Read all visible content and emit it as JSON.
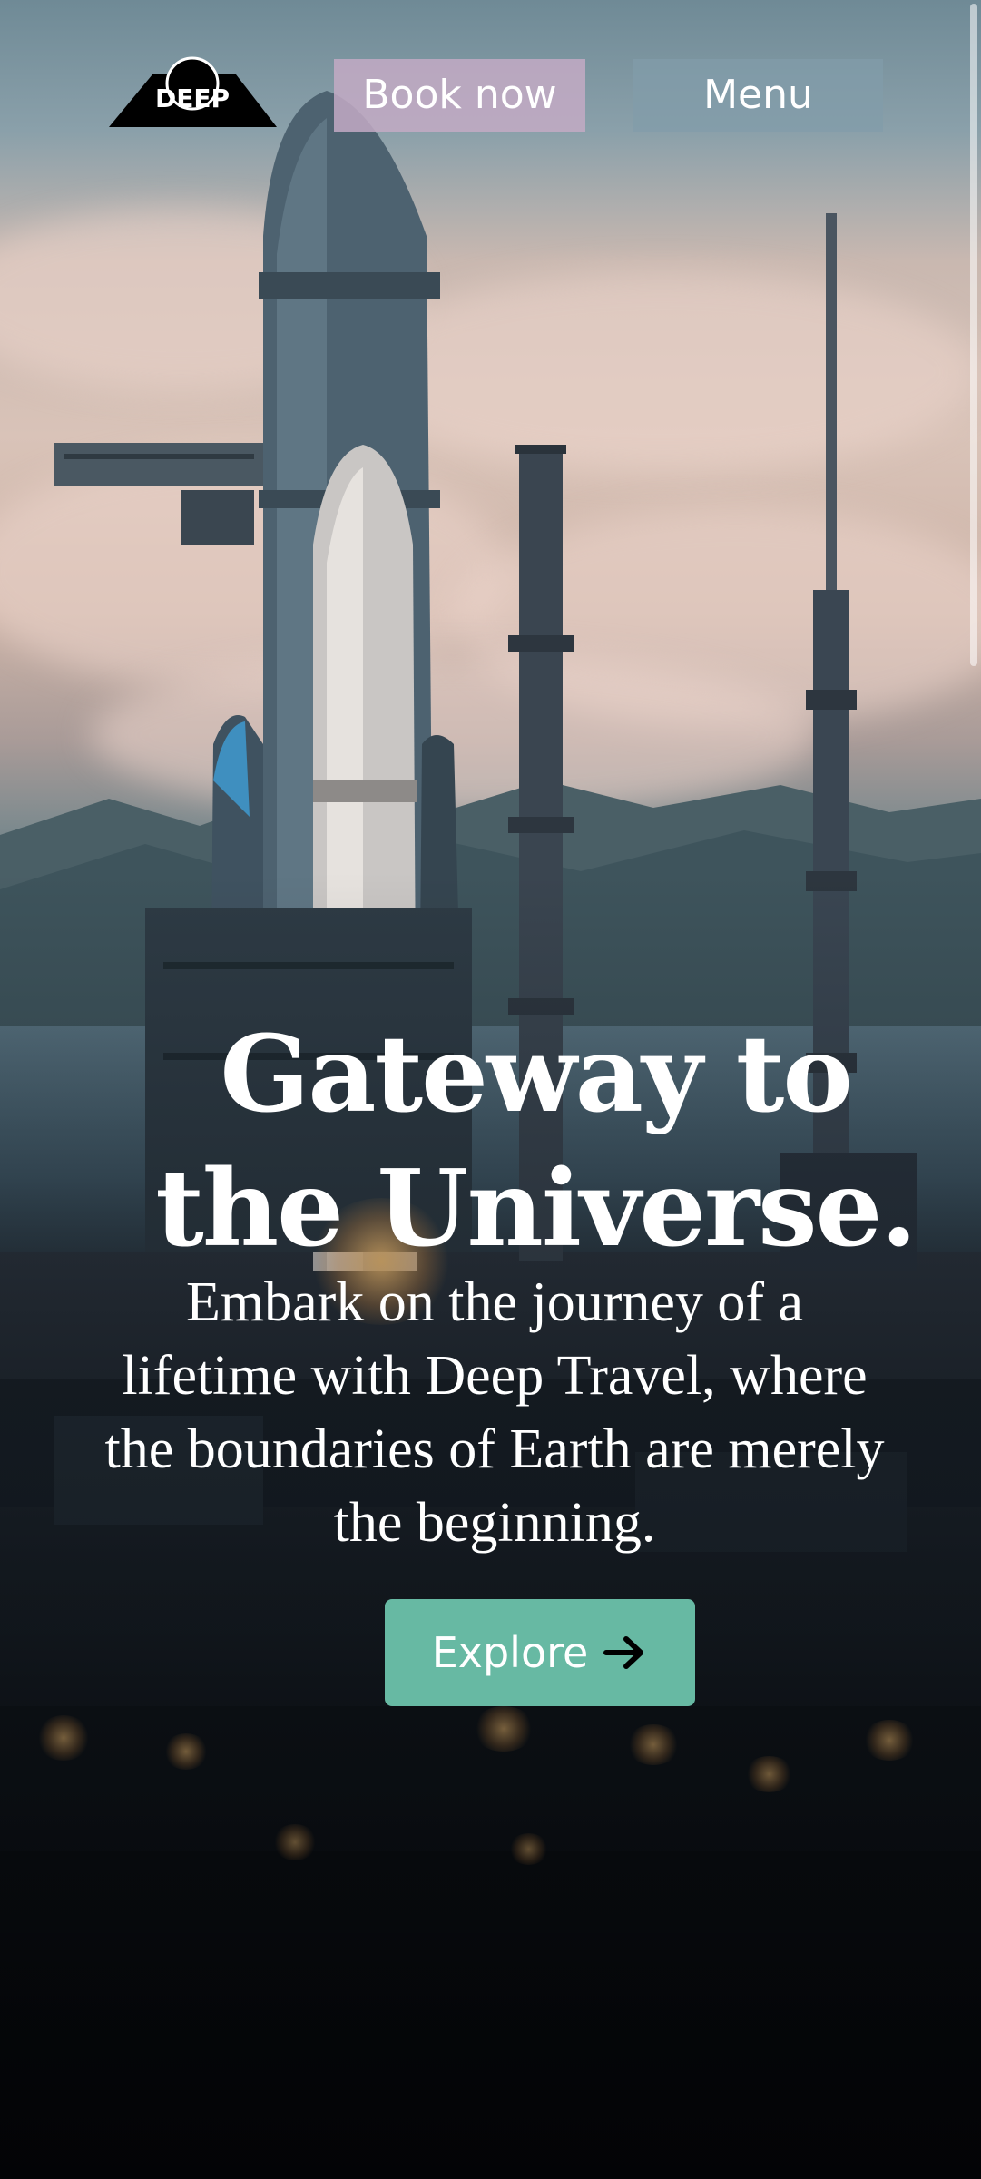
{
  "header": {
    "logo_text": "DEEP",
    "book_label": "Book now",
    "menu_label": "Menu"
  },
  "hero": {
    "title": "Gateway to the Universe.",
    "subtitle": "Embark on the journey of a lifetime with Deep Travel, where the boundaries of Earth are merely the beginning.",
    "cta_label": "Explore",
    "cta_icon": "arrow-right-icon"
  },
  "colors": {
    "book_button": "#c3aac4",
    "menu_button": "#829caa",
    "explore_button": "#67b9a3",
    "text": "#ffffff"
  }
}
